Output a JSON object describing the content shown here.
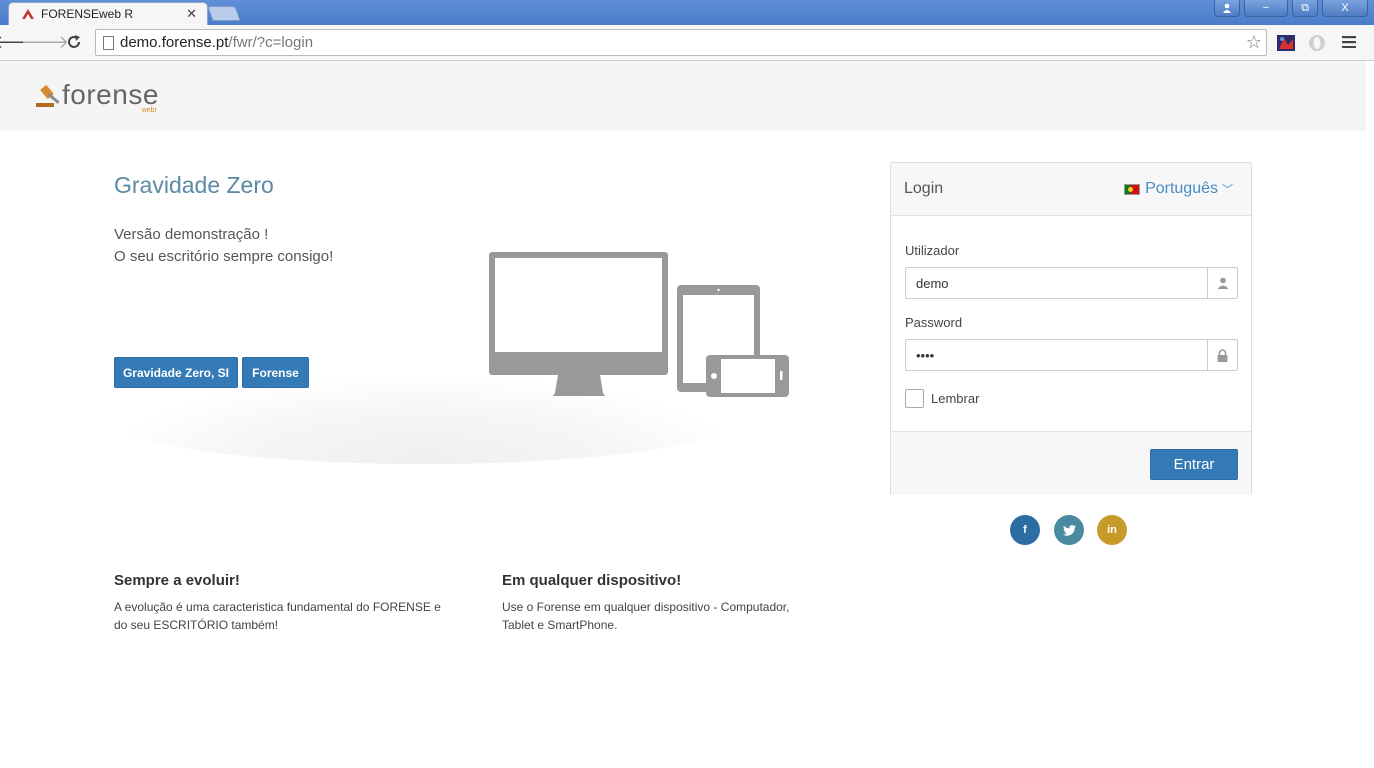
{
  "browser": {
    "tab_title": "FORENSEweb R",
    "url_host": "demo.forense.pt",
    "url_path": "/fwr/?c=login",
    "window_buttons": [
      "−",
      "⧉",
      "X"
    ]
  },
  "header": {
    "logo_text": "forense",
    "logo_sub": "webr"
  },
  "hero": {
    "title": "Gravidade Zero",
    "line1": "Versão demonstração !",
    "line2": "O seu escritório sempre consigo!",
    "button_company": "Gravidade Zero, SI",
    "button_forense": "Forense"
  },
  "login": {
    "title": "Login",
    "language": "Português",
    "user_label": "Utilizador",
    "user_value": "demo",
    "password_label": "Password",
    "password_value": "demo",
    "remember_label": "Lembrar",
    "submit_label": "Entrar"
  },
  "social": {
    "facebook": "f",
    "linkedin": "in",
    "colors": {
      "facebook": "#2e6da4",
      "twitter": "#4a8aa0",
      "linkedin": "#c89a2a"
    }
  },
  "features": [
    {
      "title": "Sempre a evoluir!",
      "text_line1": "A evolução é uma caracteristica fundamental do FORENSE e",
      "text_line2": "do seu ESCRITÓRIO também!"
    },
    {
      "title": "Em qualquer dispositivo!",
      "text_line1": "Use o Forense em qualquer dispositivo - Computador,",
      "text_line2": "Tablet e SmartPhone."
    }
  ]
}
